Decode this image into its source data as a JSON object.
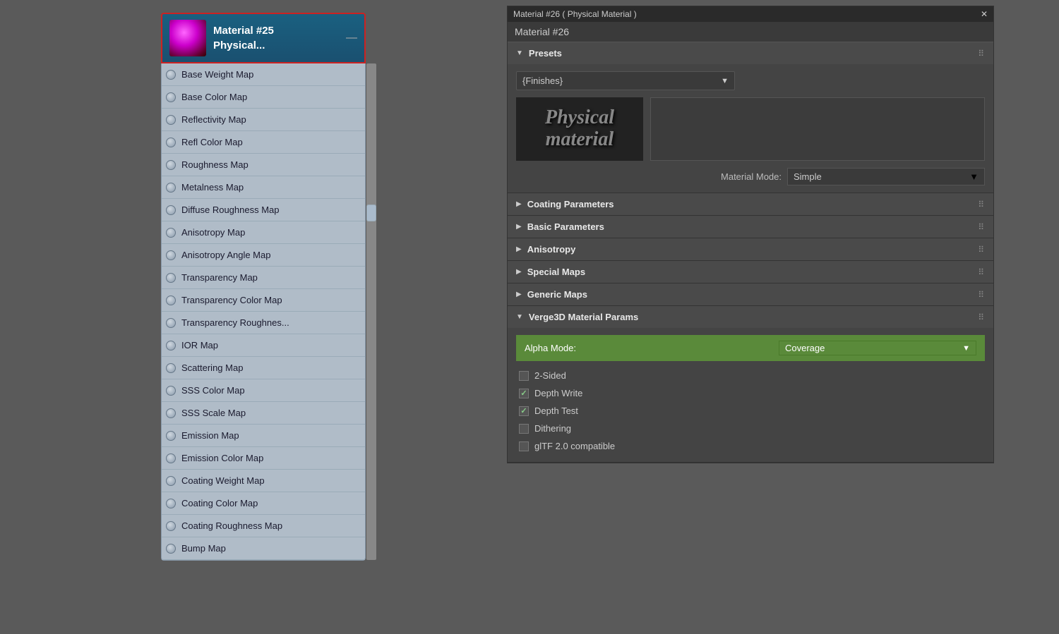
{
  "node": {
    "title_line1": "Material #25",
    "title_line2": "Physical...",
    "minimize_label": "—",
    "items": [
      {
        "label": "Base Weight Map"
      },
      {
        "label": "Base Color Map"
      },
      {
        "label": "Reflectivity Map"
      },
      {
        "label": "Refl Color Map"
      },
      {
        "label": "Roughness Map"
      },
      {
        "label": "Metalness Map"
      },
      {
        "label": "Diffuse Roughness Map"
      },
      {
        "label": "Anisotropy Map"
      },
      {
        "label": "Anisotropy Angle Map"
      },
      {
        "label": "Transparency Map"
      },
      {
        "label": "Transparency Color Map"
      },
      {
        "label": "Transparency  Roughnes..."
      },
      {
        "label": "IOR Map"
      },
      {
        "label": "Scattering Map"
      },
      {
        "label": "SSS Color Map"
      },
      {
        "label": "SSS Scale Map"
      },
      {
        "label": "Emission Map"
      },
      {
        "label": "Emission Color Map"
      },
      {
        "label": "Coating Weight Map"
      },
      {
        "label": "Coating Color Map"
      },
      {
        "label": "Coating Roughness Map"
      },
      {
        "label": "Bump Map"
      }
    ]
  },
  "right_panel": {
    "titlebar": "Material #26  ( Physical Material )",
    "close_label": "✕",
    "name_field": "Material #26",
    "sections": [
      {
        "id": "presets",
        "title": "Presets",
        "expanded": true,
        "arrow": "▼"
      },
      {
        "id": "coating",
        "title": "Coating Parameters",
        "expanded": false,
        "arrow": "▶"
      },
      {
        "id": "basic",
        "title": "Basic Parameters",
        "expanded": false,
        "arrow": "▶"
      },
      {
        "id": "anisotropy",
        "title": "Anisotropy",
        "expanded": false,
        "arrow": "▶"
      },
      {
        "id": "special",
        "title": "Special Maps",
        "expanded": false,
        "arrow": "▶"
      },
      {
        "id": "generic",
        "title": "Generic Maps",
        "expanded": false,
        "arrow": "▶"
      },
      {
        "id": "verge3d",
        "title": "Verge3D Material Params",
        "expanded": true,
        "arrow": "▼"
      }
    ],
    "presets": {
      "dropdown_text": "{Finishes}",
      "preview_text_line1": "Physical",
      "preview_text_line2": "material",
      "material_mode_label": "Material Mode:",
      "material_mode_value": "Simple"
    },
    "verge3d": {
      "alpha_mode_label": "Alpha Mode:",
      "alpha_mode_value": "Coverage",
      "checkboxes": [
        {
          "label": "2-Sided",
          "checked": false
        },
        {
          "label": "Depth Write",
          "checked": true
        },
        {
          "label": "Depth Test",
          "checked": true
        },
        {
          "label": "Dithering",
          "checked": false
        },
        {
          "label": "glTF 2.0 compatible",
          "checked": false
        }
      ]
    }
  }
}
